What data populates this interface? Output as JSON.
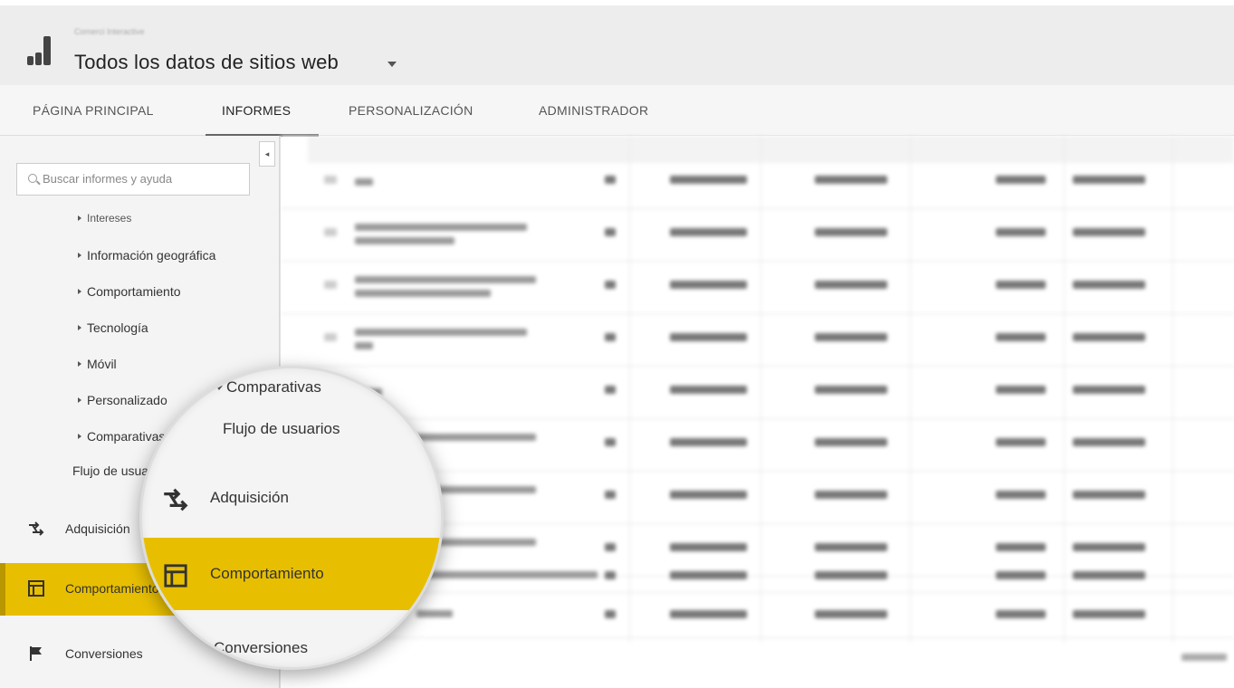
{
  "header": {
    "account_name": "Comerci Interactive",
    "property_title": "Todos los datos de sitios web"
  },
  "nav": {
    "tabs": [
      {
        "label": "PÁGINA PRINCIPAL"
      },
      {
        "label": "INFORMES"
      },
      {
        "label": "PERSONALIZACIÓN"
      },
      {
        "label": "ADMINISTRADOR"
      }
    ],
    "active_tab": "INFORMES"
  },
  "sidebar": {
    "collapse_glyph": "◂",
    "search_placeholder": "Buscar informes y ayuda",
    "sub_items": [
      {
        "label": "Intereses"
      },
      {
        "label": "Información geográfica"
      },
      {
        "label": "Comportamiento"
      },
      {
        "label": "Tecnología"
      },
      {
        "label": "Móvil"
      },
      {
        "label": "Personalizado"
      },
      {
        "label": "Comparativas"
      },
      {
        "label": "Flujo de usuarios"
      }
    ],
    "main_items": [
      {
        "label": "Adquisición",
        "icon": "acquisition-icon"
      },
      {
        "label": "Comportamiento",
        "icon": "behavior-icon",
        "active": true
      },
      {
        "label": "Conversiones",
        "icon": "flag-icon"
      }
    ]
  },
  "magnifier": {
    "items": [
      {
        "label": "Comparativas"
      },
      {
        "label": "Flujo de usuarios"
      },
      {
        "label": "Adquisición"
      },
      {
        "label": "Comportamiento"
      },
      {
        "label": "Conversiones"
      }
    ]
  },
  "colors": {
    "accent": "#e8bf00",
    "accent_dark": "#b89700",
    "header_bg": "#ededed",
    "sidebar_bg": "#f4f4f4"
  }
}
